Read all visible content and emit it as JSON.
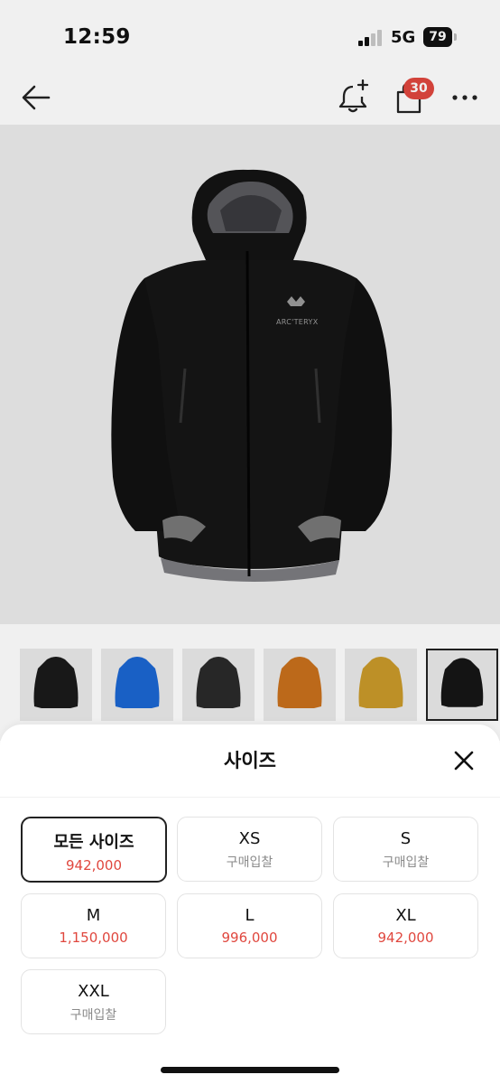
{
  "status_bar": {
    "time": "12:59",
    "network": "5G",
    "battery": "79"
  },
  "header": {
    "cart_count": "30"
  },
  "product": {
    "logo_text": "ARC'TERYX"
  },
  "thumbnails": [
    {
      "color": "#1a1a1a"
    },
    {
      "color": "#1b66d2"
    },
    {
      "color": "#2a2a2a"
    },
    {
      "color": "#c8701c"
    },
    {
      "color": "#c99a2a"
    },
    {
      "color": "#161616"
    }
  ],
  "size_sheet": {
    "title": "사이즈",
    "options": [
      {
        "size": "모든 사이즈",
        "price": "942,000"
      },
      {
        "size": "XS",
        "bid": "구매입찰"
      },
      {
        "size": "S",
        "bid": "구매입찰"
      },
      {
        "size": "M",
        "price": "1,150,000"
      },
      {
        "size": "L",
        "price": "996,000"
      },
      {
        "size": "XL",
        "price": "942,000"
      },
      {
        "size": "XXL",
        "bid": "구매입찰"
      }
    ]
  },
  "colors": {
    "accent": "#e0473e",
    "hero_bg": "#ebebeb",
    "text": "#111111"
  }
}
